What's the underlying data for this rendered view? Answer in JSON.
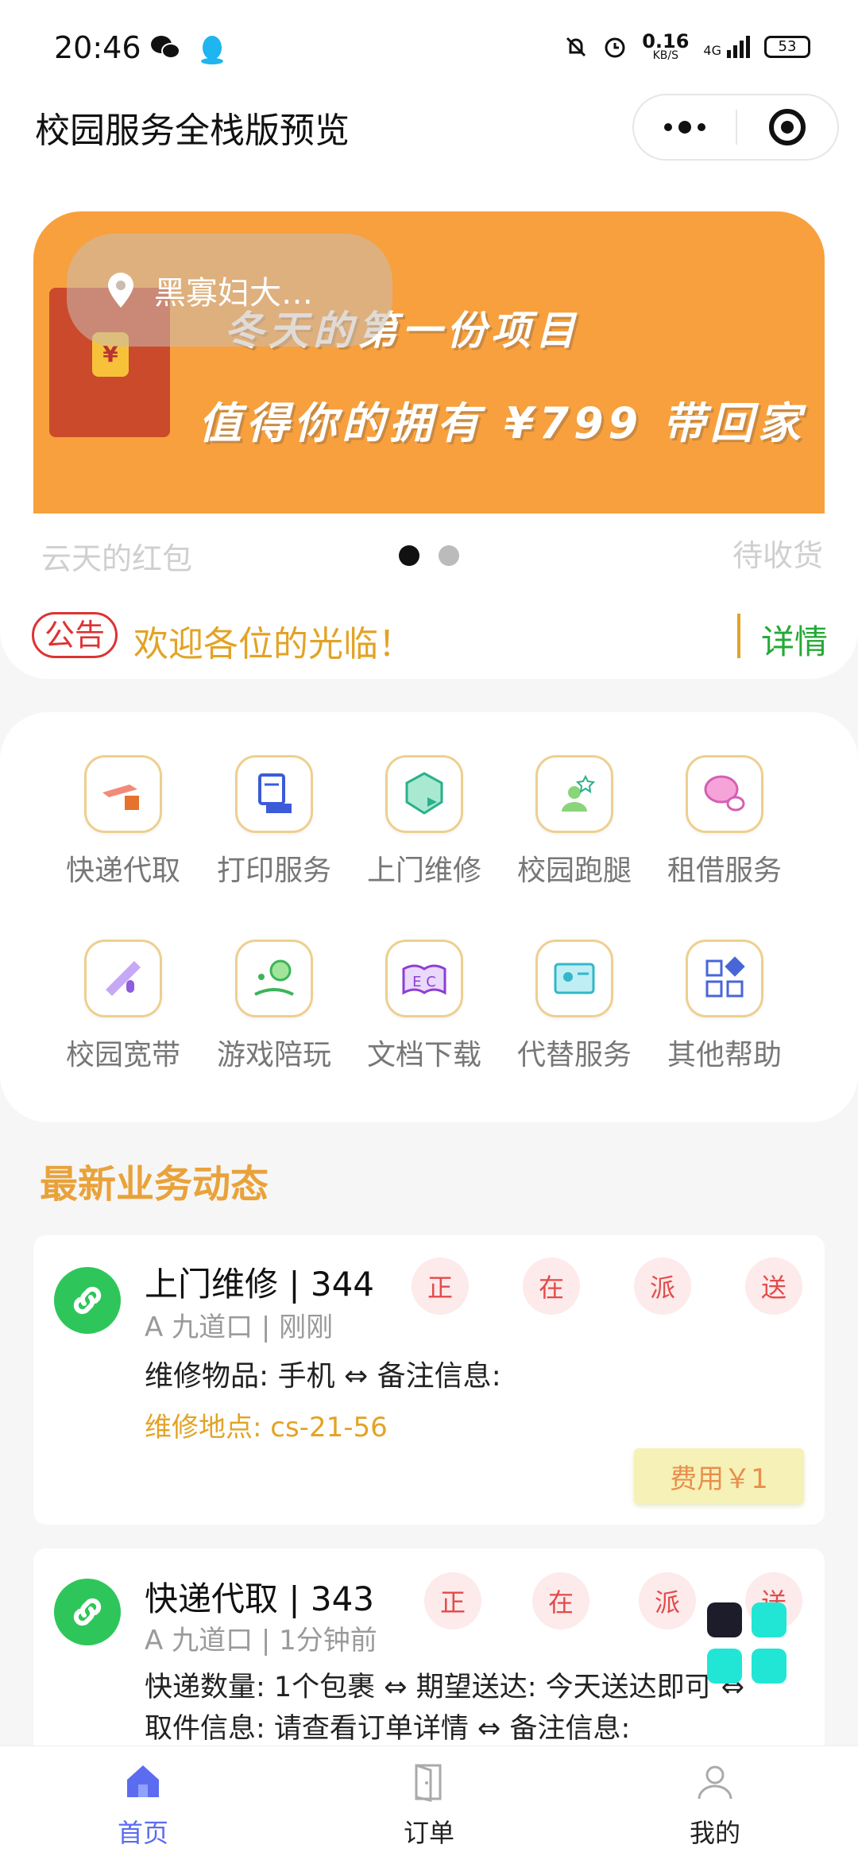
{
  "status_bar": {
    "time": "20:46",
    "net_speed": "0.16",
    "net_unit": "KB/S",
    "net_type": "4G",
    "battery": "53"
  },
  "nav": {
    "title": "校园服务全栈版预览"
  },
  "banner": {
    "location": "黑寡妇大…",
    "line1": "冬天的第一份项目",
    "line2": "值得你的拥有 ¥799 带回家",
    "envelope_symbol": "¥",
    "bg_color": "#f8a03d",
    "below_left": "云天的红包",
    "below_right": "待收货"
  },
  "notice": {
    "badge": "公告",
    "text": "欢迎各位的光临！",
    "detail": "详情"
  },
  "services": [
    {
      "label": "快递代取",
      "icon": "express-icon"
    },
    {
      "label": "打印服务",
      "icon": "print-icon"
    },
    {
      "label": "上门维修",
      "icon": "repair-icon"
    },
    {
      "label": "校园跑腿",
      "icon": "errand-icon"
    },
    {
      "label": "租借服务",
      "icon": "rent-icon"
    },
    {
      "label": "校园宽带",
      "icon": "broadband-icon"
    },
    {
      "label": "游戏陪玩",
      "icon": "game-icon"
    },
    {
      "label": "文档下载",
      "icon": "document-icon"
    },
    {
      "label": "代替服务",
      "icon": "substitute-icon"
    },
    {
      "label": "其他帮助",
      "icon": "other-help-icon"
    }
  ],
  "latest": {
    "title": "最新业务动态",
    "status_chars": [
      "正",
      "在",
      "派",
      "送"
    ],
    "orders": [
      {
        "title": "上门维修 | 344",
        "sub": "A 九道口 | 刚刚",
        "body": "维修物品: 手机 ⇔ 备注信息:",
        "address": "维修地点: cs-21-56",
        "fee": "费用￥1"
      },
      {
        "title": "快递代取 | 343",
        "sub": "A 九道口 | 1分钟前",
        "body": "快递数量: 1个包裹 ⇔ 期望送达: 今天送达即可 ⇔",
        "body2": "取件信息: 请查看订单详情 ⇔ 备注信息:"
      }
    ]
  },
  "tabbar": [
    {
      "label": "首页",
      "icon": "home-icon",
      "active": true
    },
    {
      "label": "订单",
      "icon": "door-icon",
      "active": false
    },
    {
      "label": "我的",
      "icon": "user-icon",
      "active": false
    }
  ],
  "colors": {
    "accent": "#e9a23a",
    "active_tab": "#5b6cf0",
    "green": "#2ec65a",
    "status_red": "#e34b4b"
  }
}
